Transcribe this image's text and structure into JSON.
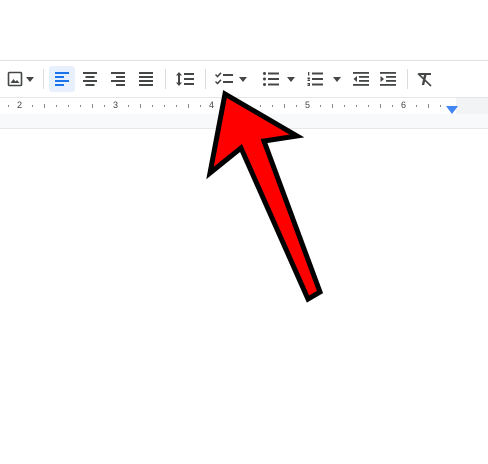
{
  "toolbar": {
    "items": [
      {
        "name": "insert-image-button",
        "icon": "image-icon"
      },
      {
        "name": "align-left-button",
        "icon": "align-left-icon",
        "active": true
      },
      {
        "name": "align-center-button",
        "icon": "align-center-icon"
      },
      {
        "name": "align-right-button",
        "icon": "align-right-icon"
      },
      {
        "name": "justify-button",
        "icon": "justify-icon"
      },
      {
        "name": "line-spacing-button",
        "icon": "line-spacing-icon"
      },
      {
        "name": "checklist-button",
        "icon": "checklist-icon"
      },
      {
        "name": "bulleted-list-button",
        "icon": "bulleted-list-icon"
      },
      {
        "name": "numbered-list-button",
        "icon": "numbered-list-icon"
      },
      {
        "name": "decrease-indent-button",
        "icon": "decrease-indent-icon"
      },
      {
        "name": "increase-indent-button",
        "icon": "increase-indent-icon"
      },
      {
        "name": "clear-formatting-button",
        "icon": "clear-formatting-icon"
      }
    ]
  },
  "ruler": {
    "labels": [
      "2",
      "3",
      "4",
      "5",
      "6"
    ]
  },
  "annotation": {
    "icon": "red-arrow-icon",
    "color": "#ff0000"
  },
  "colors": {
    "accent": "#1a73e8",
    "icon": "#444746"
  }
}
